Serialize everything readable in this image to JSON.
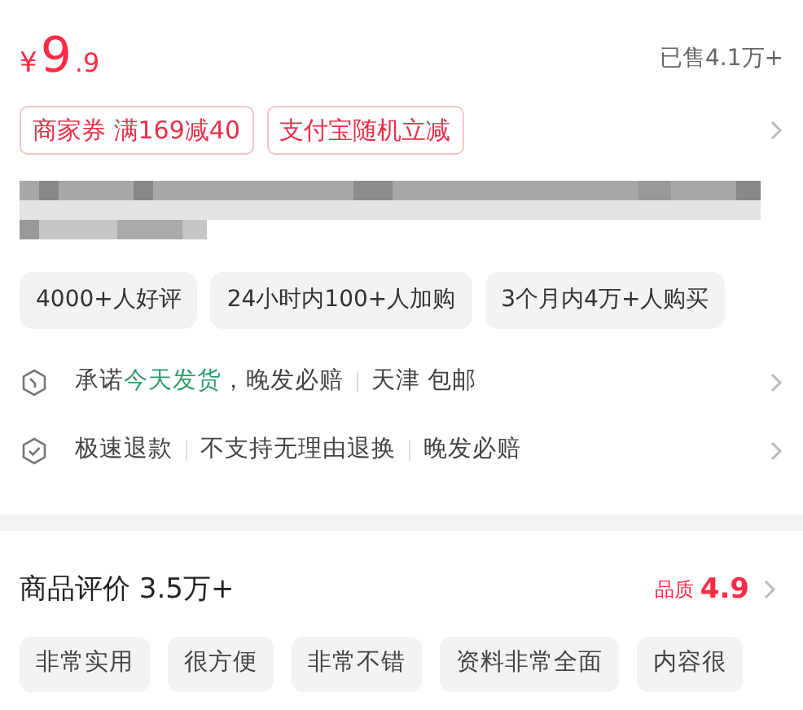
{
  "price": {
    "currency": "¥",
    "integer": "9",
    "decimal": ".9"
  },
  "sold": "已售4.1万+",
  "coupons": [
    "商家券 满169减40",
    "支付宝随机立减"
  ],
  "title": {
    "kind": "picture"
  },
  "highlights": [
    "4000+人好评",
    "24小时内100+人加购",
    "3个月内4万+人购买"
  ],
  "services": [
    {
      "kind": "shipping",
      "parts": [
        {
          "text": "承诺",
          "accent": false
        },
        {
          "text": "今天发货",
          "accent": true
        },
        {
          "text": "，晚发必赔",
          "accent": false
        }
      ],
      "extra": [
        "天津 包邮"
      ]
    },
    {
      "kind": "refund",
      "parts": [
        {
          "text": "极速退款",
          "accent": false
        }
      ],
      "extra": [
        "不支持无理由退换",
        "晚发必赔"
      ]
    }
  ],
  "reviews": {
    "title": "商品评价 3.5万+",
    "quality_label": "品质",
    "quality_score": "4.9",
    "tags": [
      "非常实用",
      "很方便",
      "非常不错",
      "资料非常全面",
      "内容很"
    ]
  }
}
